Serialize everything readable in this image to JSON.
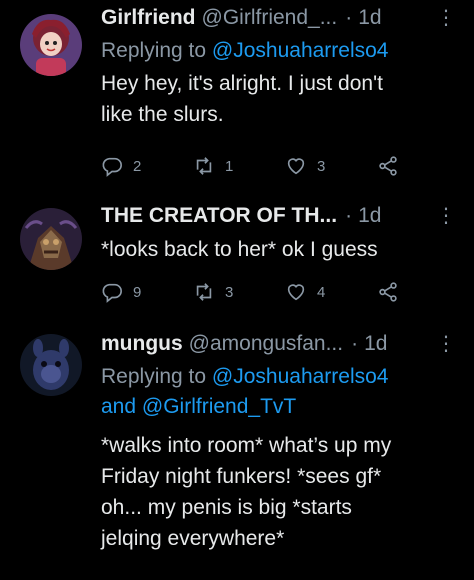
{
  "tweets": [
    {
      "name": "Girlfriend",
      "handle": "@Girlfriend_...",
      "dot": "·",
      "time": "1d",
      "replying_prefix": "Replying to",
      "replying_to": "@Joshuaharrelso4",
      "text_lines": [
        "Hey hey, it's alright. I just don't",
        "like the slurs."
      ],
      "replies": "2",
      "retweets": "1",
      "likes": "3"
    },
    {
      "name": "THE CREATOR OF TH...",
      "dot": "·",
      "time": "1d",
      "text_lines": [
        "*looks back to her* ok I guess"
      ],
      "replies": "9",
      "retweets": "3",
      "likes": "4"
    },
    {
      "name": "mungus",
      "handle": "@amongusfan...",
      "dot": "·",
      "time": "1d",
      "replying_prefix": "Replying to",
      "replying_to": "@Joshuaharrelso4",
      "replying_and": "and",
      "replying_to_2": "@Girlfriend_TvT",
      "text_lines": [
        "*walks into room* what’s up my",
        "Friday night funkers! *sees gf*",
        "oh... my penis is big *starts",
        "jelqing everywhere*"
      ]
    }
  ],
  "icons": {
    "reply": "reply-icon",
    "retweet": "retweet-icon",
    "like": "heart-icon",
    "share": "share-icon",
    "more": "more-icon"
  },
  "colors": {
    "background": "#000000",
    "text": "#e7e9ea",
    "muted": "#8b98a5",
    "link": "#1d9bf0"
  }
}
